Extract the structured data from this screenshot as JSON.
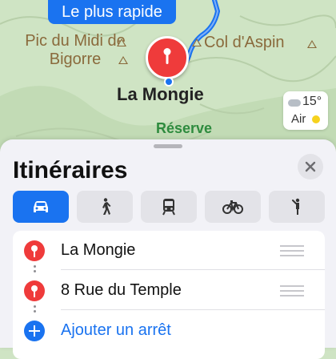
{
  "map": {
    "route_option": "Le plus rapide",
    "poi_midi": "Pic du Midi de Bigorre",
    "poi_aspin": "Col d'Aspin",
    "place": "La Mongie",
    "reserve": "Réserve",
    "weather": {
      "temperature": "15°",
      "air": "Air",
      "cloud_icon": "cloud-icon",
      "air_quality_color": "#f6d21e"
    }
  },
  "sheet": {
    "title": "Itinéraires",
    "close_icon": "close-icon",
    "modes": [
      {
        "icon": "car-icon",
        "active": true
      },
      {
        "icon": "walk-icon",
        "active": false
      },
      {
        "icon": "transit-icon",
        "active": false
      },
      {
        "icon": "bike-icon",
        "active": false
      },
      {
        "icon": "rideshare-icon",
        "active": false
      }
    ],
    "stops": [
      {
        "label": "La Mongie"
      },
      {
        "label": "8 Rue du Temple"
      }
    ],
    "add_stop": "Ajouter un arrêt"
  },
  "colors": {
    "accent": "#1a73f0",
    "pin": "#ef3b3b",
    "poi": "#8a6a3c",
    "reserve": "#2e8b3e"
  }
}
